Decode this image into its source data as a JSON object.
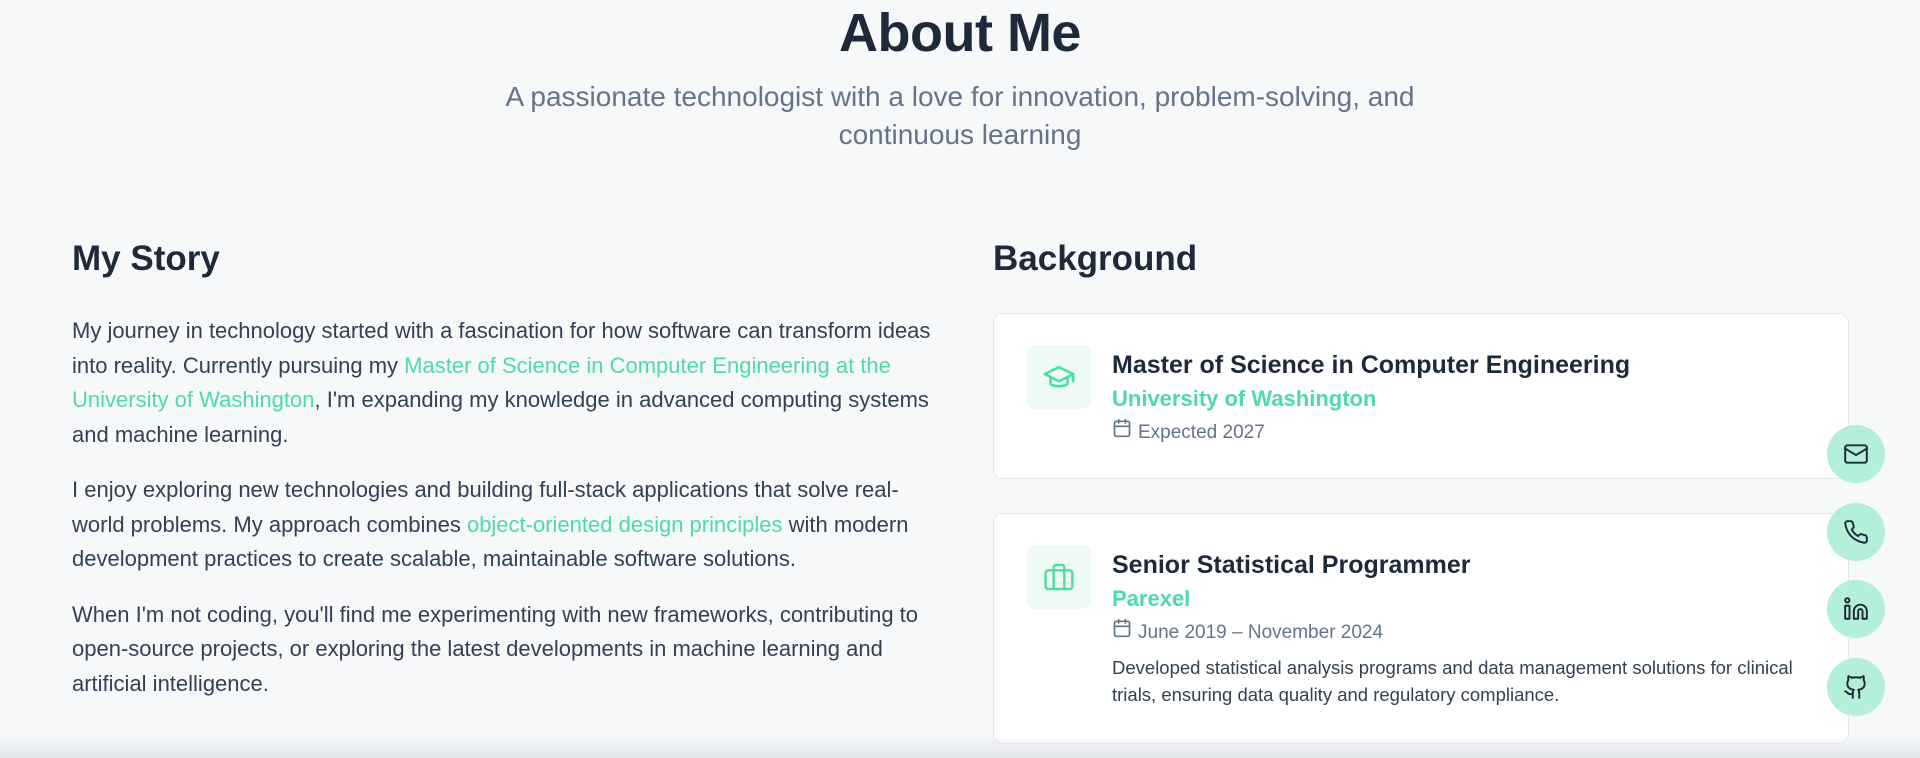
{
  "header": {
    "title": "About Me",
    "subtitle": "A passionate technologist with a love for innovation, problem-solving, and continuous learning"
  },
  "story": {
    "heading": "My Story",
    "p1_before": "My journey in technology started with a fascination for how software can transform ideas into reality. Currently pursuing my ",
    "p1_link": "Master of Science in Computer Engineering at the University of Washington",
    "p1_after": ", I'm expanding my knowledge in advanced computing systems and machine learning.",
    "p2_before": "I enjoy exploring new technologies and building full-stack applications that solve real-world problems. My approach combines ",
    "p2_link": "object-oriented design principles",
    "p2_after": " with modern development practices to create scalable, maintainable software solutions.",
    "p3": "When I'm not coding, you'll find me experimenting with new frameworks, contributing to open-source projects, or exploring the latest developments in machine learning and artificial intelligence."
  },
  "background": {
    "heading": "Background",
    "items": [
      {
        "icon": "graduation-cap-icon",
        "title": "Master of Science in Computer Engineering",
        "organization": "University of Washington",
        "date": "Expected 2027"
      },
      {
        "icon": "briefcase-icon",
        "title": "Senior Statistical Programmer",
        "organization": "Parexel",
        "date": "June 2019 – November 2024",
        "description": "Developed statistical analysis programs and data management solutions for clinical trials, ensuring data quality and regulatory compliance."
      }
    ]
  },
  "contact_buttons": [
    "mail-icon",
    "phone-icon",
    "linkedin-icon",
    "github-icon"
  ],
  "colors": {
    "accent": "#4ddba6",
    "heading": "#1e293b",
    "muted": "#64748b",
    "fab_bg": "#b4efd9",
    "page_bg": "#f6f8fa"
  }
}
